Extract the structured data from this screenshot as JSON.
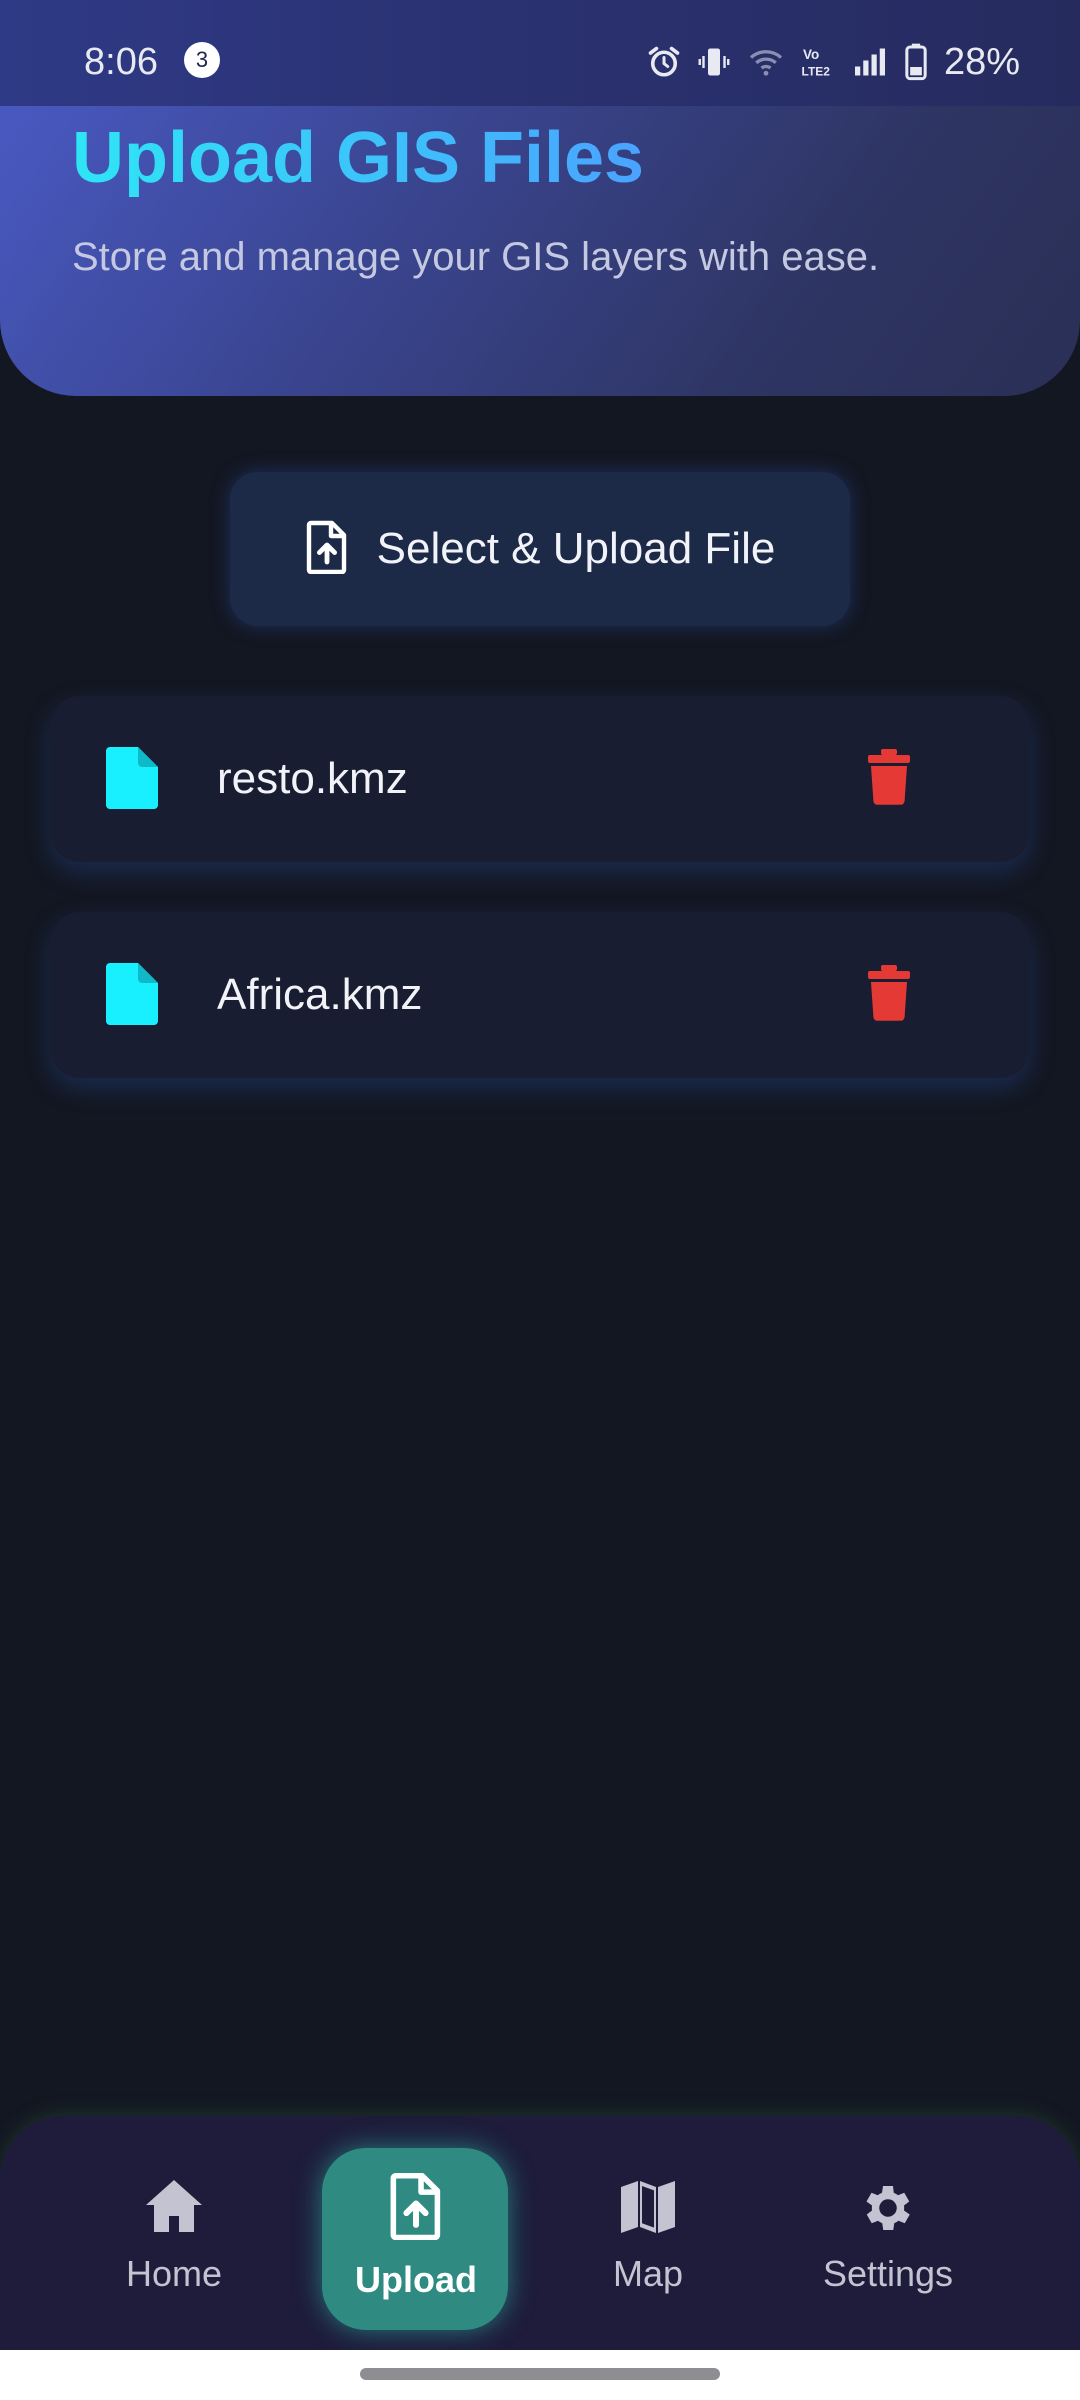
{
  "status_bar": {
    "time": "8:06",
    "notification_count": "3",
    "volte_label": "Vo LTE2",
    "battery": "28%"
  },
  "header": {
    "title": "Upload GIS Files",
    "subtitle": "Store and manage your GIS layers with ease."
  },
  "upload": {
    "button_label": "Select & Upload File"
  },
  "files": [
    {
      "name": "resto.kmz"
    },
    {
      "name": "Africa.kmz"
    }
  ],
  "nav": {
    "items": [
      {
        "label": "Home",
        "icon": "home-icon"
      },
      {
        "label": "Upload",
        "icon": "upload-file-icon",
        "active": true
      },
      {
        "label": "Map",
        "icon": "map-icon"
      },
      {
        "label": "Settings",
        "icon": "gear-icon"
      }
    ]
  },
  "colors": {
    "accent_cyan": "#18f0ff",
    "delete_red": "#e53935",
    "active_tab": "#2f8b82",
    "background": "#131722"
  }
}
